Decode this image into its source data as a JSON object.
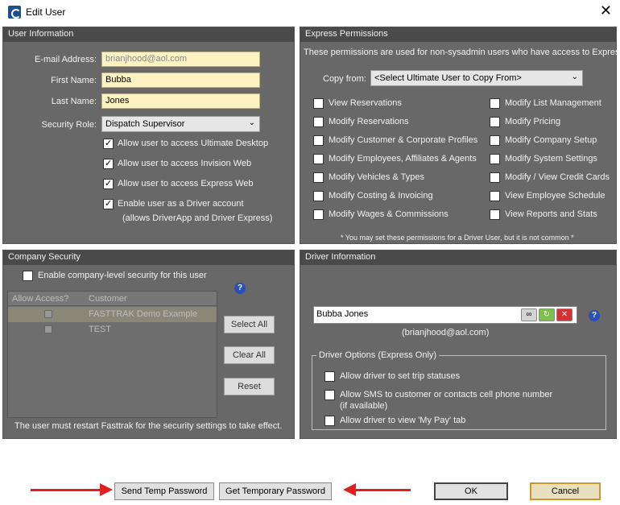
{
  "window": {
    "title": "Edit User",
    "close_glyph": "✕"
  },
  "user_info": {
    "header": "User Information",
    "email_label": "E-mail Address:",
    "email_value": "brianjhood@aol.com",
    "first_label": "First Name:",
    "first_value": "Bubba",
    "last_label": "Last Name:",
    "last_value": "Jones",
    "role_label": "Security Role:",
    "role_value": "Dispatch Supervisor",
    "options": [
      {
        "label": "Allow user to access Ultimate Desktop",
        "checked": true
      },
      {
        "label": "Allow user to access Invision Web",
        "checked": true
      },
      {
        "label": "Allow user to access Express Web",
        "checked": true
      },
      {
        "label": "Enable user as a Driver account",
        "checked": true
      }
    ],
    "driver_note": "(allows DriverApp and Driver Express)"
  },
  "express_permissions": {
    "header": "Express Permissions",
    "description": "These permissions are used for non-sysadmin users who have access to Express.",
    "copy_from_label": "Copy from:",
    "copy_from_value": "<Select Ultimate User to Copy From>",
    "left": [
      "View Reservations",
      "Modify Reservations",
      "Modify Customer & Corporate Profiles",
      "Modify Employees, Affiliates & Agents",
      "Modify Vehicles & Types",
      "Modify Costing & Invoicing",
      "Modify Wages & Commissions"
    ],
    "right": [
      "Modify List Management",
      "Modify Pricing",
      "Modify Company Setup",
      "Modify System Settings",
      "Modify / View Credit Cards",
      "View Employee Schedule",
      "View Reports and Stats"
    ],
    "footnote": "* You may set these permissions for a Driver User, but it is not common *"
  },
  "company_security": {
    "header": "Company Security",
    "enable_label": "Enable company-level security for this user",
    "col_access": "Allow Access?",
    "col_customer": "Customer",
    "rows": [
      "FASTTRAK Demo Example",
      "TEST"
    ],
    "select_all": "Select All",
    "clear_all": "Clear All",
    "reset": "Reset",
    "restart_note": "The user must restart Fasttrak for the security settings to take effect."
  },
  "driver_info": {
    "header": "Driver Information",
    "driver_name": "Bubba Jones",
    "driver_email": "(brianjhood@aol.com)",
    "options_legend": "Driver Options (Express Only)",
    "options": [
      "Allow driver to set trip statuses",
      "Allow SMS to customer or contacts cell phone number",
      "Allow driver to view 'My Pay' tab"
    ],
    "sms_note": "(if available)"
  },
  "footer": {
    "send_temp": "Send Temp Password",
    "get_temp": "Get Temporary Password",
    "ok": "OK",
    "cancel": "Cancel"
  },
  "colors": {
    "arrow": "#e02020",
    "panel": "#686868",
    "field": "#fdf3c2"
  }
}
